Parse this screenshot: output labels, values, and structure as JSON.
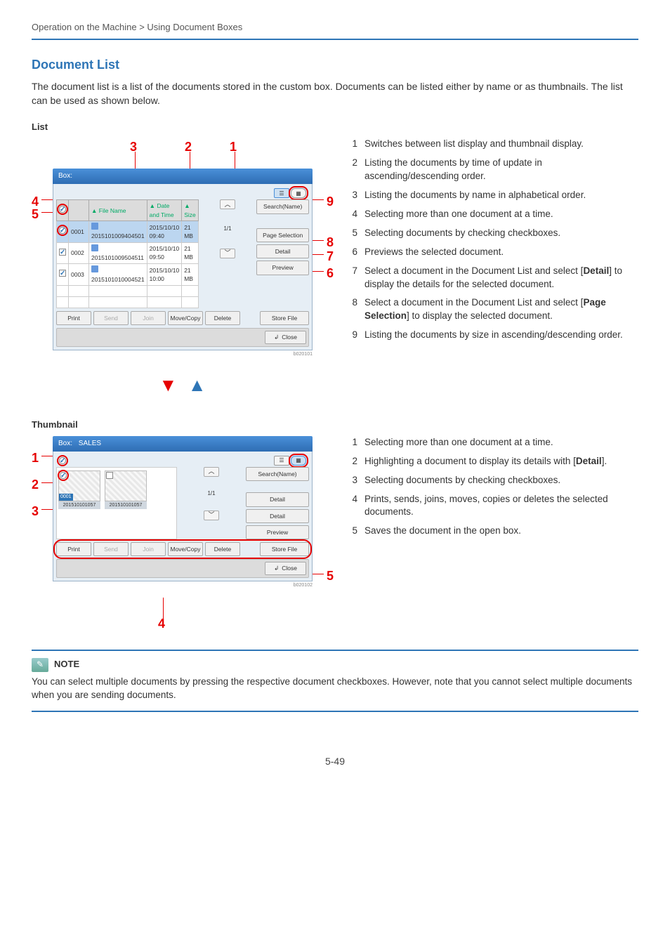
{
  "breadcrumb": "Operation on the Machine > Using Document Boxes",
  "title": "Document List",
  "intro": "The document list is a list of the documents stored in the custom box. Documents can be listed either by name or as thumbnails. The list can be used as shown below.",
  "list_label": "List",
  "thumb_label": "Thumbnail",
  "page_number": "5-49",
  "list_panel": {
    "box_label": "Box:",
    "cols": {
      "chk": "",
      "name": "File Name",
      "date": "Date and Time",
      "size": "Size"
    },
    "rows": [
      {
        "idx": "0001",
        "name": "2015101009404501",
        "date": "2015/10/10 09:40",
        "size": "21 MB",
        "sel": true
      },
      {
        "idx": "0002",
        "name": "2015101009504511",
        "date": "2015/10/10 09:50",
        "size": "21 MB",
        "sel": true
      },
      {
        "idx": "0003",
        "name": "2015101010004521",
        "date": "2015/10/10 10:00",
        "size": "21 MB",
        "sel": true
      }
    ],
    "pager": "1/1",
    "side": {
      "search": "Search(Name)",
      "pagesel": "Page Selection",
      "detail": "Detail",
      "preview": "Preview"
    },
    "actions": {
      "print": "Print",
      "send": "Send",
      "join": "Join",
      "move": "Move/Copy",
      "delete": "Delete",
      "store": "Store File"
    },
    "close": "Close",
    "id": "b020101"
  },
  "thumb_panel": {
    "box_label": "Box:",
    "box_name": "SALES",
    "thumbs": [
      {
        "cap": "201510101057",
        "tag": "0001",
        "chk": true
      },
      {
        "cap": "201510101057",
        "tag": "",
        "chk": false
      }
    ],
    "pager": "1/1",
    "side": {
      "search": "Search(Name)",
      "detail1": "Detail",
      "detail2": "Detail",
      "preview": "Preview"
    },
    "actions": {
      "print": "Print",
      "send": "Send",
      "join": "Join",
      "move": "Move/Copy",
      "delete": "Delete",
      "store": "Store File"
    },
    "close": "Close",
    "id": "b020102"
  },
  "list_desc": [
    {
      "n": "1",
      "t": "Switches between list display and thumbnail display."
    },
    {
      "n": "2",
      "t": "Listing the documents by time of update in ascending/descending order."
    },
    {
      "n": "3",
      "t": "Listing the documents by name in alphabetical order."
    },
    {
      "n": "4",
      "t": "Selecting more than one document at a time."
    },
    {
      "n": "5",
      "t": "Selecting documents by checking checkboxes."
    },
    {
      "n": "6",
      "t": "Previews the selected document."
    },
    {
      "n": "7",
      "t_pre": "Select a document in the Document List and select [",
      "t_b": "Detail",
      "t_post": "] to display the details for the selected document."
    },
    {
      "n": "8",
      "t_pre": "Select a document in the Document List and select [",
      "t_b": "Page Selection",
      "t_post": "] to display the selected document."
    },
    {
      "n": "9",
      "t": "Listing the documents by size in ascending/descending order."
    }
  ],
  "thumb_desc": [
    {
      "n": "1",
      "t": "Selecting more than one document at a time."
    },
    {
      "n": "2",
      "t_pre": "Highlighting a document to display its details with [",
      "t_b": "Detail",
      "t_post": "]."
    },
    {
      "n": "3",
      "t": "Selecting documents by checking checkboxes."
    },
    {
      "n": "4",
      "t": "Prints, sends, joins, moves, copies or deletes the selected documents."
    },
    {
      "n": "5",
      "t": "Saves the document in the open box."
    }
  ],
  "note": {
    "title": "NOTE",
    "text": "You can select multiple documents by pressing the respective document checkboxes. However, note that you cannot select multiple documents when you are sending documents."
  }
}
